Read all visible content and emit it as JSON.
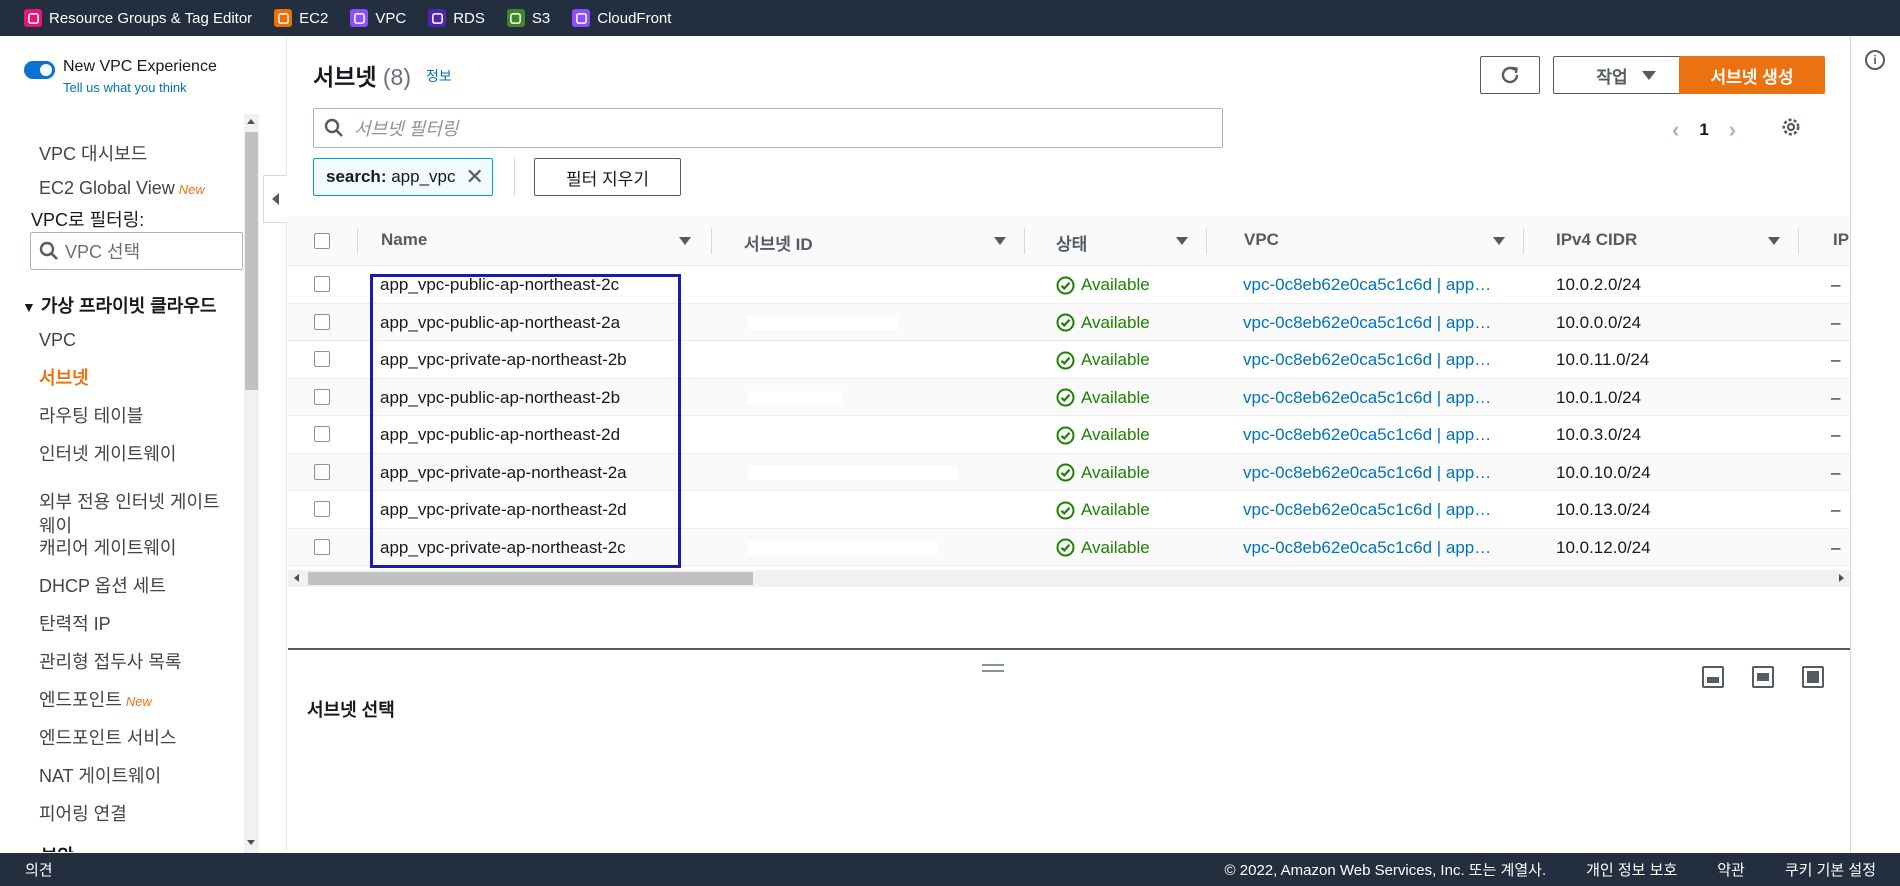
{
  "topbar": {
    "favorites": [
      {
        "label": "Resource Groups & Tag Editor",
        "icon": "resource-groups-icon",
        "color": "#e7157b"
      },
      {
        "label": "EC2",
        "icon": "ec2-icon",
        "color": "#ed7100"
      },
      {
        "label": "VPC",
        "icon": "vpc-icon",
        "color": "#8c4fff"
      },
      {
        "label": "RDS",
        "icon": "rds-icon",
        "color": "#4d27aa"
      },
      {
        "label": "S3",
        "icon": "s3-icon",
        "color": "#3f8624"
      },
      {
        "label": "CloudFront",
        "icon": "cloudfront-icon",
        "color": "#8c4fff"
      }
    ]
  },
  "sidebar": {
    "toggle_label": "New VPC Experience",
    "toggle_link": "Tell us what you think",
    "top_items": [
      {
        "label": "VPC 대시보드",
        "new": ""
      },
      {
        "label": "EC2 Global View",
        "new": "New"
      }
    ],
    "filter_label": "VPC로 필터링:",
    "filter_placeholder": "VPC 선택",
    "section_title": "가상 프라이빗 클라우드",
    "items": [
      {
        "label": "VPC",
        "new": ""
      },
      {
        "label": "서브넷",
        "new": "",
        "active": true
      },
      {
        "label": "라우팅 테이블",
        "new": ""
      },
      {
        "label": "인터넷 게이트웨이",
        "new": ""
      },
      {
        "label": "외부 전용 인터넷 게이트\n웨이",
        "new": ""
      },
      {
        "label": "캐리어 게이트웨이",
        "new": ""
      },
      {
        "label": "DHCP 옵션 세트",
        "new": ""
      },
      {
        "label": "탄력적 IP",
        "new": ""
      },
      {
        "label": "관리형 접두사 목록",
        "new": ""
      },
      {
        "label": "엔드포인트",
        "new": "New"
      },
      {
        "label": "엔드포인트 서비스",
        "new": ""
      },
      {
        "label": "NAT 게이트웨이",
        "new": ""
      },
      {
        "label": "피어링 연결",
        "new": ""
      }
    ],
    "next_section": "보안"
  },
  "main": {
    "title": "서브넷",
    "count": "(8)",
    "info_link": "정보",
    "actions_label": "작업",
    "create_label": "서브넷 생성",
    "search_placeholder": "서브넷 필터링",
    "page": "1",
    "token_key": "search:",
    "token_value": "app_vpc",
    "clear_filters": "필터 지우기",
    "columns": [
      "Name",
      "서브넷 ID",
      "상태",
      "VPC",
      "IPv4 CIDR",
      "IP"
    ],
    "rows": [
      {
        "name": "app_vpc-public-ap-northeast-2c",
        "status": "Available",
        "vpc": "vpc-0c8eb62e0ca5c1c6d | app…",
        "cidr": "10.0.2.0/24",
        "ipv6": "–"
      },
      {
        "name": "app_vpc-public-ap-northeast-2a",
        "status": "Available",
        "vpc": "vpc-0c8eb62e0ca5c1c6d | app…",
        "cidr": "10.0.0.0/24",
        "ipv6": "–"
      },
      {
        "name": "app_vpc-private-ap-northeast-2b",
        "status": "Available",
        "vpc": "vpc-0c8eb62e0ca5c1c6d | app…",
        "cidr": "10.0.11.0/24",
        "ipv6": "–"
      },
      {
        "name": "app_vpc-public-ap-northeast-2b",
        "status": "Available",
        "vpc": "vpc-0c8eb62e0ca5c1c6d | app…",
        "cidr": "10.0.1.0/24",
        "ipv6": "–"
      },
      {
        "name": "app_vpc-public-ap-northeast-2d",
        "status": "Available",
        "vpc": "vpc-0c8eb62e0ca5c1c6d | app…",
        "cidr": "10.0.3.0/24",
        "ipv6": "–"
      },
      {
        "name": "app_vpc-private-ap-northeast-2a",
        "status": "Available",
        "vpc": "vpc-0c8eb62e0ca5c1c6d | app…",
        "cidr": "10.0.10.0/24",
        "ipv6": "–"
      },
      {
        "name": "app_vpc-private-ap-northeast-2d",
        "status": "Available",
        "vpc": "vpc-0c8eb62e0ca5c1c6d | app…",
        "cidr": "10.0.13.0/24",
        "ipv6": "–"
      },
      {
        "name": "app_vpc-private-ap-northeast-2c",
        "status": "Available",
        "vpc": "vpc-0c8eb62e0ca5c1c6d | app…",
        "cidr": "10.0.12.0/24",
        "ipv6": "–"
      }
    ],
    "split_title": "서브넷 선택"
  },
  "footer": {
    "feedback": "의견",
    "copyright": "© 2022, Amazon Web Services, Inc. 또는 계열사.",
    "privacy": "개인 정보 보호",
    "terms": "약관",
    "cookies": "쿠키 기본 설정"
  },
  "colors": {
    "accent": "#ec7211",
    "link": "#0073bb",
    "success": "#1d8102",
    "nav_dark": "#232f3e",
    "highlight_box": "#1a1ab0"
  }
}
